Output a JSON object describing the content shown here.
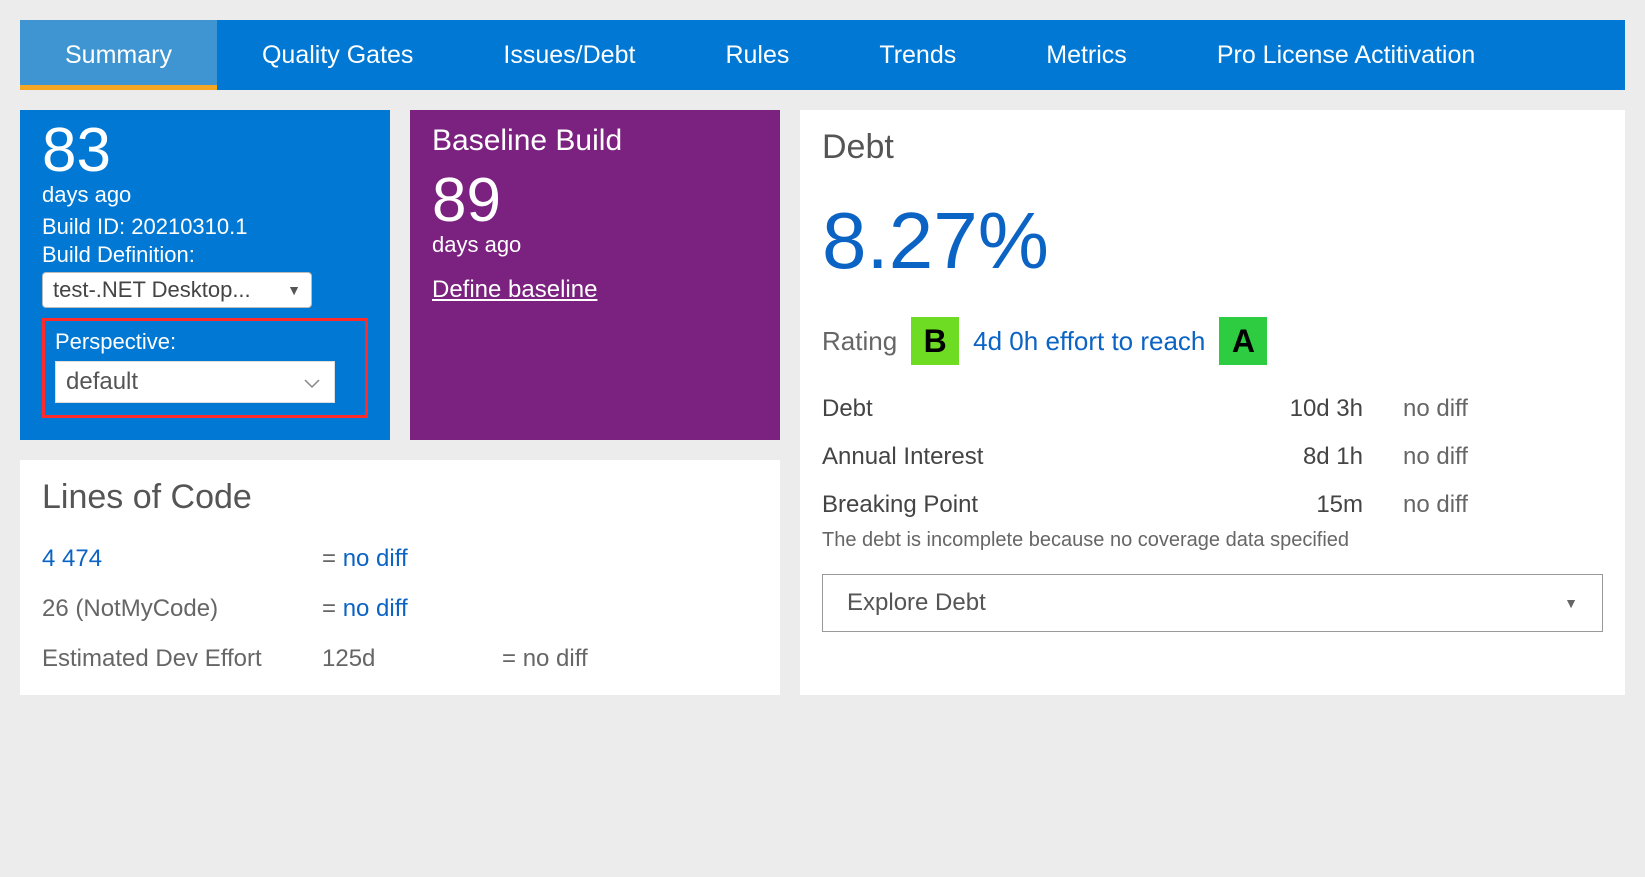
{
  "tabs": {
    "summary": "Summary",
    "quality_gates": "Quality Gates",
    "issues_debt": "Issues/Debt",
    "rules": "Rules",
    "trends": "Trends",
    "metrics": "Metrics",
    "license": "Pro License Actitivation"
  },
  "build": {
    "days": "83",
    "days_label": "days ago",
    "id_label": "Build ID: 20210310.1",
    "def_label": "Build Definition:",
    "def_select": "test-.NET Desktop...",
    "persp_label": "Perspective:",
    "persp_select": "default"
  },
  "baseline": {
    "title": "Baseline Build",
    "days": "89",
    "days_label": "days ago",
    "define": "Define baseline"
  },
  "loc": {
    "title": "Lines of Code",
    "total": "4 474",
    "total_diff_eq": "= ",
    "total_diff": "no diff",
    "notmycode": "26 (NotMyCode)",
    "notmycode_diff_eq": "= ",
    "notmycode_diff": "no diff",
    "est_label": "Estimated Dev Effort",
    "est_val": "125d",
    "est_diff_eq": "= ",
    "est_diff": "no diff"
  },
  "debt": {
    "title": "Debt",
    "pct": "8.27%",
    "rating_label": "Rating",
    "rating_badge": "B",
    "effort": "4d 0h effort to reach",
    "target_badge": "A",
    "rows": {
      "r1l": "Debt",
      "r1v": "10d 3h",
      "r1d": "no diff",
      "r2l": "Annual Interest",
      "r2v": "8d 1h",
      "r2d": "no diff",
      "r3l": "Breaking Point",
      "r3v": "15m",
      "r3d": "no diff"
    },
    "note": "The debt is incomplete because no coverage data specified",
    "explore": "Explore Debt"
  }
}
